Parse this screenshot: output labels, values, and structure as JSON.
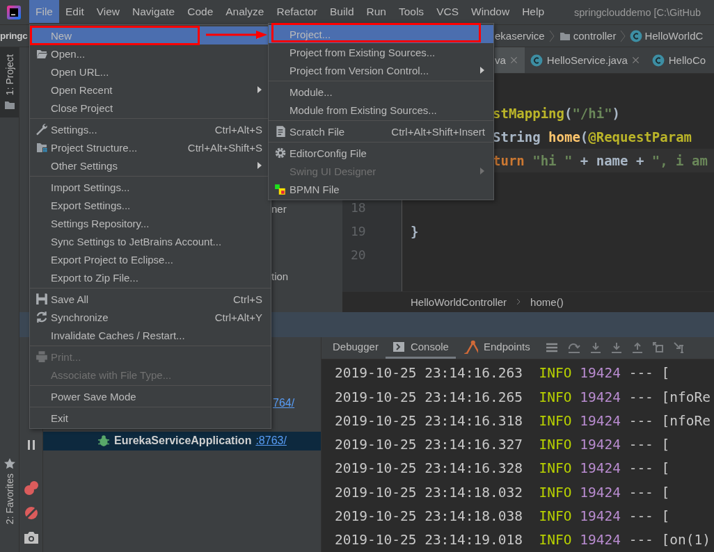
{
  "menubar": {
    "items": [
      {
        "label": "File",
        "selected": true
      },
      {
        "label": "Edit",
        "selected": false
      },
      {
        "label": "View",
        "selected": false
      },
      {
        "label": "Navigate",
        "selected": false
      },
      {
        "label": "Code",
        "selected": false
      },
      {
        "label": "Analyze",
        "selected": false
      },
      {
        "label": "Refactor",
        "selected": false
      },
      {
        "label": "Build",
        "selected": false
      },
      {
        "label": "Run",
        "selected": false
      },
      {
        "label": "Tools",
        "selected": false
      },
      {
        "label": "VCS",
        "selected": false
      },
      {
        "label": "Window",
        "selected": false
      },
      {
        "label": "Help",
        "selected": false
      }
    ],
    "title": "springclouddemo [C:\\GitHub"
  },
  "navbar": {
    "project": "pringc",
    "crumbs": [
      {
        "label": "ekaservice",
        "kind": "plain"
      },
      {
        "label": "controller",
        "kind": "folder"
      },
      {
        "label": "HelloWorldC",
        "kind": "class"
      }
    ]
  },
  "tool_strip": {
    "top": {
      "label": "1: Project",
      "selected": true
    },
    "bottom": {
      "label": "2: Favorites",
      "selected": false
    }
  },
  "project_panel": {
    "fragments": [
      "ner",
      "tion"
    ]
  },
  "editor": {
    "tabs": [
      {
        "label": "va",
        "selected": true,
        "clipped": true,
        "closable": true
      },
      {
        "label": "HelloService.java",
        "selected": false,
        "clipped": false,
        "closable": true
      },
      {
        "label": "HelloCo",
        "selected": false,
        "clipped": false,
        "closable": false
      }
    ],
    "lines": [
      {
        "kind": "blank"
      },
      {
        "kind": "clipped",
        "tokens": [
          {
            "text": "stMapping",
            "kind": "annotation"
          },
          {
            "text": "(",
            "kind": "plain"
          },
          {
            "text": "\"/hi\"",
            "kind": "string"
          },
          {
            "text": ")",
            "kind": "plain"
          }
        ]
      },
      {
        "kind": "clipped",
        "tokens": [
          {
            "text": "String ",
            "kind": "plain"
          },
          {
            "text": "home",
            "kind": "method"
          },
          {
            "text": "(",
            "kind": "plain"
          },
          {
            "text": "@RequestParam",
            "kind": "annotation"
          }
        ]
      },
      {
        "kind": "clipped",
        "current": true,
        "tokens": [
          {
            "text": "turn ",
            "kind": "keyword"
          },
          {
            "text": "\"hi \"",
            "kind": "string"
          },
          {
            "text": " + name + ",
            "kind": "plain"
          },
          {
            "text": "\", i am",
            "kind": "string"
          }
        ]
      },
      {
        "kind": "blank"
      },
      {
        "kind": "code",
        "number": "18"
      },
      {
        "kind": "code",
        "number": "19",
        "tokens": [
          {
            "text": "}",
            "kind": "plain"
          }
        ]
      },
      {
        "kind": "code",
        "number": "20"
      }
    ],
    "breadcrumb": [
      "HelloWorldController",
      "home()"
    ]
  },
  "debug": {
    "tree": [
      {
        "port": "764/",
        "selected": false
      },
      {
        "selected": false
      },
      {
        "name": "EurekaServiceApplication",
        "port": ":8763/",
        "selected": true
      }
    ],
    "tabs": [
      {
        "label": "Debugger",
        "selected": false
      },
      {
        "label": "Console",
        "selected": true
      },
      {
        "label": "Endpoints",
        "selected": false
      }
    ],
    "console": [
      {
        "time": "2019-10-25 23:14:16.263",
        "level": "INFO",
        "pid": "19424",
        "separator": "---",
        "thread": "["
      },
      {
        "time": "2019-10-25 23:14:16.265",
        "level": "INFO",
        "pid": "19424",
        "separator": "---",
        "thread": "[nfoRe"
      },
      {
        "time": "2019-10-25 23:14:16.318",
        "level": "INFO",
        "pid": "19424",
        "separator": "---",
        "thread": "[nfoRe"
      },
      {
        "time": "2019-10-25 23:14:16.327",
        "level": "INFO",
        "pid": "19424",
        "separator": "---",
        "thread": "["
      },
      {
        "time": "2019-10-25 23:14:16.328",
        "level": "INFO",
        "pid": "19424",
        "separator": "---",
        "thread": "["
      },
      {
        "time": "2019-10-25 23:14:18.032",
        "level": "INFO",
        "pid": "19424",
        "separator": "---",
        "thread": "["
      },
      {
        "time": "2019-10-25 23:14:18.038",
        "level": "INFO",
        "pid": "19424",
        "separator": "---",
        "thread": "["
      },
      {
        "time": "2019-10-25 23:14:19.018",
        "level": "INFO",
        "pid": "19424",
        "separator": "---",
        "thread": "[on(1)"
      }
    ]
  },
  "file_menu": [
    {
      "kind": "item",
      "label": "New",
      "selected": true,
      "disabled": false,
      "submenu": true
    },
    {
      "kind": "item",
      "label": "Open...",
      "selected": false,
      "disabled": false
    },
    {
      "kind": "item",
      "label": "Open URL...",
      "selected": false,
      "disabled": false
    },
    {
      "kind": "item",
      "label": "Open Recent",
      "selected": false,
      "disabled": false,
      "submenu": true
    },
    {
      "kind": "item",
      "label": "Close Project",
      "selected": false,
      "disabled": false
    },
    {
      "kind": "separator"
    },
    {
      "kind": "item",
      "label": "Settings...",
      "shortcut": "Ctrl+Alt+S",
      "selected": false,
      "disabled": false
    },
    {
      "kind": "item",
      "label": "Project Structure...",
      "shortcut": "Ctrl+Alt+Shift+S",
      "selected": false,
      "disabled": false
    },
    {
      "kind": "item",
      "label": "Other Settings",
      "selected": false,
      "disabled": false,
      "submenu": true
    },
    {
      "kind": "separator"
    },
    {
      "kind": "item",
      "label": "Import Settings...",
      "selected": false,
      "disabled": false
    },
    {
      "kind": "item",
      "label": "Export Settings...",
      "selected": false,
      "disabled": false
    },
    {
      "kind": "item",
      "label": "Settings Repository...",
      "selected": false,
      "disabled": false
    },
    {
      "kind": "item",
      "label": "Sync Settings to JetBrains Account...",
      "selected": false,
      "disabled": false
    },
    {
      "kind": "item",
      "label": "Export Project to Eclipse...",
      "selected": false,
      "disabled": false
    },
    {
      "kind": "item",
      "label": "Export to Zip File...",
      "selected": false,
      "disabled": false
    },
    {
      "kind": "separator"
    },
    {
      "kind": "item",
      "label": "Save All",
      "shortcut": "Ctrl+S",
      "selected": false,
      "disabled": false
    },
    {
      "kind": "item",
      "label": "Synchronize",
      "shortcut": "Ctrl+Alt+Y",
      "selected": false,
      "disabled": false
    },
    {
      "kind": "item",
      "label": "Invalidate Caches / Restart...",
      "selected": false,
      "disabled": false
    },
    {
      "kind": "separator"
    },
    {
      "kind": "item",
      "label": "Print...",
      "selected": false,
      "disabled": true
    },
    {
      "kind": "item",
      "label": "Associate with File Type...",
      "selected": false,
      "disabled": true
    },
    {
      "kind": "separator"
    },
    {
      "kind": "item",
      "label": "Power Save Mode",
      "selected": false,
      "disabled": false
    },
    {
      "kind": "separator"
    },
    {
      "kind": "item",
      "label": "Exit",
      "selected": false,
      "disabled": false
    }
  ],
  "new_submenu": [
    {
      "kind": "item",
      "label": "Project...",
      "selected": true,
      "disabled": false
    },
    {
      "kind": "item",
      "label": "Project from Existing Sources...",
      "selected": false,
      "disabled": false
    },
    {
      "kind": "item",
      "label": "Project from Version Control...",
      "selected": false,
      "disabled": false,
      "submenu": true
    },
    {
      "kind": "separator"
    },
    {
      "kind": "item",
      "label": "Module...",
      "selected": false,
      "disabled": false
    },
    {
      "kind": "item",
      "label": "Module from Existing Sources...",
      "selected": false,
      "disabled": false
    },
    {
      "kind": "separator"
    },
    {
      "kind": "item",
      "label": "Scratch File",
      "shortcut": "Ctrl+Alt+Shift+Insert",
      "selected": false,
      "disabled": false
    },
    {
      "kind": "separator"
    },
    {
      "kind": "item",
      "label": "EditorConfig File",
      "selected": false,
      "disabled": false
    },
    {
      "kind": "item",
      "label": "Swing UI Designer",
      "selected": false,
      "disabled": true,
      "submenu": true
    },
    {
      "kind": "item",
      "label": "BPMN File",
      "selected": false,
      "disabled": false
    }
  ]
}
